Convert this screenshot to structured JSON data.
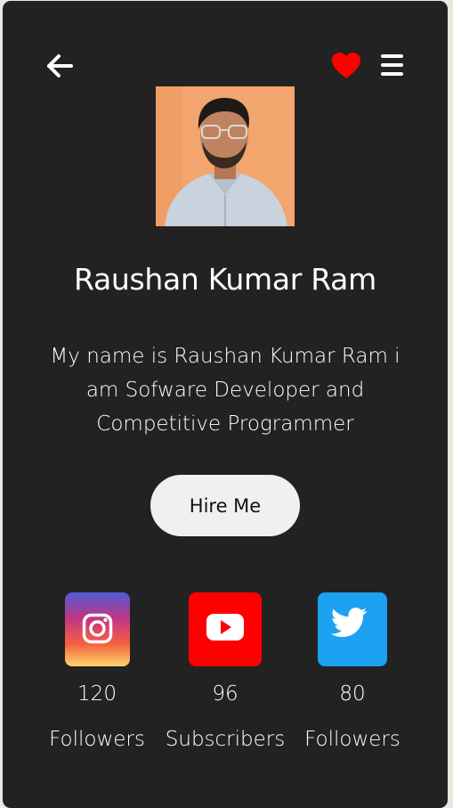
{
  "profile": {
    "name": "Raushan Kumar Ram",
    "bio": "My name is Raushan Kumar Ram i am Sofware Developer and Competitive Programmer",
    "hire_label": "Hire Me"
  },
  "header": {
    "back_icon": "arrow-left-icon",
    "favorite_icon": "heart-icon",
    "menu_icon": "hamburger-menu-icon",
    "favorite_color": "#ff0000"
  },
  "social": [
    {
      "platform": "instagram",
      "icon": "instagram-icon",
      "count": "120",
      "label": "Followers"
    },
    {
      "platform": "youtube",
      "icon": "youtube-icon",
      "count": "96",
      "label": "Subscribers",
      "color": "#ff0000"
    },
    {
      "platform": "twitter",
      "icon": "twitter-icon",
      "count": "80",
      "label": "Followers",
      "color": "#1da1f2"
    }
  ],
  "colors": {
    "card_background": "#222222",
    "page_background": "#ebe7df",
    "button_background": "#f0f0f0"
  }
}
